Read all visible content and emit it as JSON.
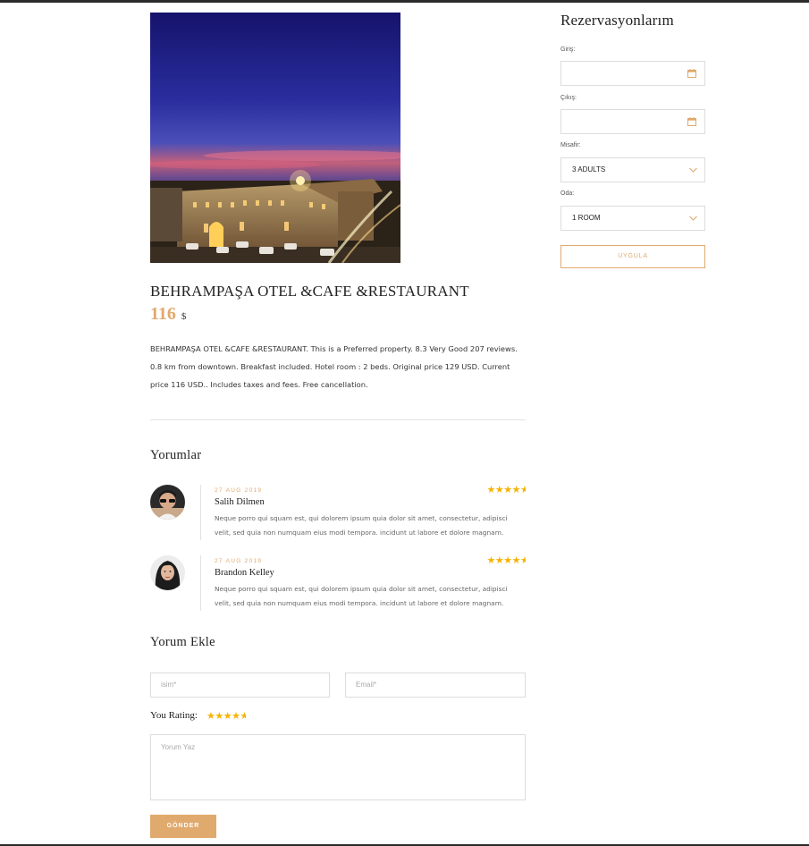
{
  "hotel": {
    "name": "BEHRAMPAŞA OTEL &CAFE &RESTAURANT",
    "price": "116",
    "currency": "$",
    "description": "BEHRAMPAŞA OTEL &CAFE &RESTAURANT. This is a Preferred property. 8.3 Very Good 207 reviews. 0.8 km from downtown. Breakfast included. Hotel room : 2 beds. Original price 129 USD. Current price 116 USD.. Includes taxes and fees. Free cancellation."
  },
  "reviews": {
    "title": "Yorumlar",
    "items": [
      {
        "date": "27 AUG 2019",
        "name": "Salih Dilmen",
        "text": "Neque porro qui squam est, qui dolorem ipsum quia dolor sit amet, consectetur, adipisci velit, sed quia non numquam eius modi tempora. incidunt ut labore et dolore magnam.",
        "rating": 4.5
      },
      {
        "date": "27 AUG 2019",
        "name": "Brandon Kelley",
        "text": "Neque porro qui squam est, qui dolorem ipsum quia dolor sit amet, consectetur, adipisci velit, sed quia non numquam eius modi tempora. incidunt ut labore et dolore magnam.",
        "rating": 4.5
      }
    ]
  },
  "comment_form": {
    "title": "Yorum Ekle",
    "name_placeholder": "isim*",
    "email_placeholder": "Email*",
    "rating_label": "You Rating:",
    "rating": 4.5,
    "message_placeholder": "Yorum Yaz",
    "submit_label": "GÖNDER"
  },
  "sidebar": {
    "title": "Rezervasyonlarım",
    "checkin_label": "Giriş:",
    "checkout_label": "Çıkış:",
    "guests_label": "Misafir:",
    "guests_value": "3 ADULTS",
    "rooms_label": "Oda:",
    "rooms_value": "1 ROOM",
    "apply_label": "UYGULA"
  },
  "colors": {
    "accent": "#e0a96d",
    "star": "#f5b301"
  },
  "icons": {
    "calendar": "calendar-icon",
    "chevron": "chevron-down-icon",
    "star": "star-icon"
  }
}
